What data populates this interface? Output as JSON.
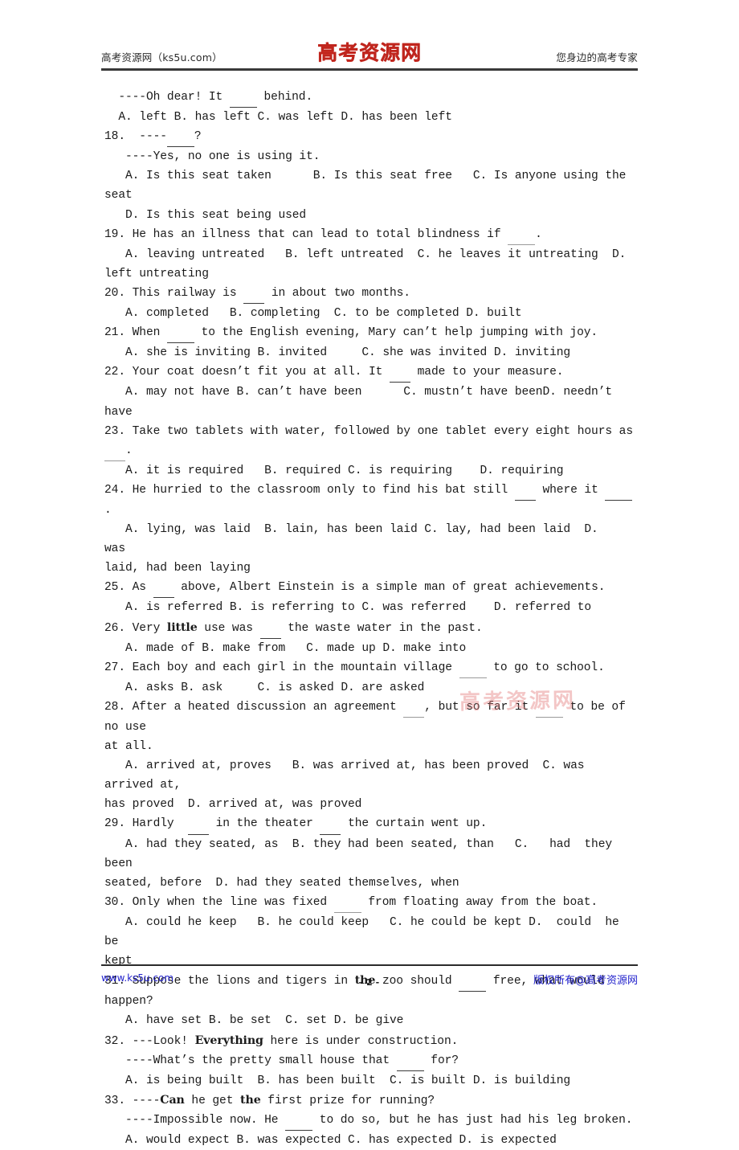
{
  "header": {
    "left_text": "高考资源网（ks5u.com）",
    "logo_text": "高考资源网",
    "right_text": "您身边的高考专家",
    "logo_color": "#c0251d"
  },
  "watermark": {
    "text": "高考资源网",
    "color": "#e27878"
  },
  "footer": {
    "left_text": "www.ks5u.com",
    "page_number": "- 2 -",
    "right_text": "版权所有@高考资源网",
    "link_color": "#2222cc"
  },
  "body": {
    "lines": [
      {
        "id": "l01",
        "segs": [
          {
            "t": "  ----Oh dear! It "
          },
          {
            "blank": "bl-m"
          },
          {
            "t": " behind."
          }
        ]
      },
      {
        "id": "l02",
        "segs": [
          {
            "t": "  A. left B. has left C. was left D. has been left"
          }
        ]
      },
      {
        "id": "l03",
        "segs": [
          {
            "t": "18.  ----"
          },
          {
            "blank": "bl-m"
          },
          {
            "t": "?"
          }
        ]
      },
      {
        "id": "l04",
        "segs": [
          {
            "t": "   ----Yes, no one is using it."
          }
        ]
      },
      {
        "id": "l05",
        "segs": [
          {
            "t": "   A. Is this seat taken      B. Is this seat free   C. Is anyone using the seat"
          }
        ]
      },
      {
        "id": "l06",
        "segs": [
          {
            "t": "   D. Is this seat being used"
          }
        ]
      },
      {
        "id": "l07",
        "segs": [
          {
            "t": "19. He has an illness that can lead to total blindness if "
          },
          {
            "blank": "bl-m bl-gr"
          },
          {
            "t": "."
          }
        ]
      },
      {
        "id": "l08",
        "segs": [
          {
            "t": "   A. leaving untreated   B. left untreated  C. he leaves it untreating  D."
          }
        ]
      },
      {
        "id": "l09",
        "segs": [
          {
            "t": "left untreating"
          }
        ]
      },
      {
        "id": "l10",
        "segs": [
          {
            "t": "20. This railway is "
          },
          {
            "blank": "bl-s"
          },
          {
            "t": " in about two months."
          }
        ]
      },
      {
        "id": "l11",
        "segs": [
          {
            "t": "   A. completed   B. completing  C. to be completed D. built"
          }
        ]
      },
      {
        "id": "l12",
        "segs": [
          {
            "t": "21. When "
          },
          {
            "blank": "bl-m"
          },
          {
            "t": " to the English evening, Mary can’t help jumping with joy."
          }
        ]
      },
      {
        "id": "l13",
        "segs": [
          {
            "t": "   A. she is inviting B. invited     C. she was invited D. inviting"
          }
        ]
      },
      {
        "id": "l14",
        "segs": [
          {
            "t": "22. Your coat doesn’t fit you at all. It "
          },
          {
            "blank": "bl-s"
          },
          {
            "t": " made to your measure."
          }
        ]
      },
      {
        "id": "l15",
        "segs": [
          {
            "t": "   A. may not have B. can’t have been      C. mustn’t have beenD. needn’t have"
          }
        ]
      },
      {
        "id": "l16",
        "segs": [
          {
            "t": "23. Take two tablets with water, followed by one tablet every eight hours as "
          },
          {
            "blank": "bl-s bl-gr"
          },
          {
            "t": "."
          }
        ]
      },
      {
        "id": "l17",
        "segs": [
          {
            "t": "   A. it is required   B. required C. is requiring    D. requiring"
          }
        ]
      },
      {
        "id": "l18",
        "segs": [
          {
            "t": "24. He hurried to the classroom only to find his bat still "
          },
          {
            "blank": "bl-s"
          },
          {
            "t": " where it "
          },
          {
            "blank": "bl-m"
          },
          {
            "t": "."
          }
        ]
      },
      {
        "id": "l19",
        "segs": [
          {
            "t": "   A. lying, was laid  B. lain, has been laid C. lay, had been laid  D.    was"
          }
        ]
      },
      {
        "id": "l20",
        "segs": [
          {
            "t": "laid, had been laying"
          }
        ]
      },
      {
        "id": "l21",
        "segs": [
          {
            "t": "25. As "
          },
          {
            "blank": "bl-s"
          },
          {
            "t": " above, Albert Einstein is a simple man of great achievements."
          }
        ]
      },
      {
        "id": "l22",
        "segs": [
          {
            "t": "   A. is referred B. is referring to C. was referred    D. referred to"
          }
        ]
      },
      {
        "id": "l23",
        "segs": [
          {
            "t": "26. Very "
          },
          {
            "b": "little"
          },
          {
            "t": " use was "
          },
          {
            "blank": "bl-s"
          },
          {
            "t": " the waste water in the past."
          }
        ]
      },
      {
        "id": "l24",
        "segs": [
          {
            "t": "   A. made of B. make from   C. made up D. make into"
          }
        ]
      },
      {
        "id": "l25",
        "segs": [
          {
            "t": "27. Each boy and each girl in the mountain village "
          },
          {
            "blank": "bl-m bl-gr"
          },
          {
            "t": " to go to school."
          }
        ]
      },
      {
        "id": "l26",
        "segs": [
          {
            "t": "   A. asks B. ask     C. is asked D. are asked"
          }
        ]
      },
      {
        "id": "l27",
        "segs": [
          {
            "t": "28. After a heated discussion an agreement "
          },
          {
            "blank": "bl-s bl-gr"
          },
          {
            "t": ", but so far it "
          },
          {
            "blank": "bl-m bl-gr"
          },
          {
            "t": " to be of no use"
          }
        ]
      },
      {
        "id": "l28",
        "segs": [
          {
            "t": "at all."
          }
        ]
      },
      {
        "id": "l29",
        "segs": [
          {
            "t": "   A. arrived at, proves   B. was arrived at, has been proved  C. was arrived at,"
          }
        ]
      },
      {
        "id": "l30",
        "segs": [
          {
            "t": "has proved  D. arrived at, was proved"
          }
        ]
      },
      {
        "id": "l31",
        "segs": [
          {
            "t": "29. Hardly  "
          },
          {
            "blank": "bl-s"
          },
          {
            "t": " in the theater "
          },
          {
            "blank": "bl-s"
          },
          {
            "t": " the curtain went up."
          }
        ]
      },
      {
        "id": "l32",
        "segs": [
          {
            "t": "   A. had they seated, as  B. they had been seated, than   C.   had  they  been"
          }
        ]
      },
      {
        "id": "l33",
        "segs": [
          {
            "t": "seated, before  D. had they seated themselves, when"
          }
        ]
      },
      {
        "id": "l34",
        "segs": [
          {
            "t": "30. Only when the line was fixed "
          },
          {
            "blank": "bl-m bl-gr"
          },
          {
            "t": " from floating away from the boat."
          }
        ]
      },
      {
        "id": "l35",
        "segs": [
          {
            "t": "   A. could he keep   B. he could keep   C. he could be kept D.  could  he  be"
          }
        ]
      },
      {
        "id": "l36",
        "segs": [
          {
            "t": "kept"
          }
        ]
      },
      {
        "id": "l37",
        "segs": [
          {
            "t": "31. Suppose the lions and tigers in "
          },
          {
            "b": "the"
          },
          {
            "t": " zoo should "
          },
          {
            "blank": "bl-m"
          },
          {
            "t": " free, what would happen?"
          }
        ]
      },
      {
        "id": "l38",
        "segs": [
          {
            "t": "   A. have set B. be set  C. set D. be give"
          }
        ]
      },
      {
        "id": "l39",
        "segs": [
          {
            "t": "32. ---Look! "
          },
          {
            "b": "Everything"
          },
          {
            "t": " here is under construction."
          }
        ]
      },
      {
        "id": "l40",
        "segs": [
          {
            "t": "   ----What’s the pretty small house that "
          },
          {
            "blank": "bl-m"
          },
          {
            "t": " for?"
          }
        ]
      },
      {
        "id": "l41",
        "segs": [
          {
            "t": "   A. is being built  B. has been built  C. is built D. is building"
          }
        ]
      },
      {
        "id": "l42",
        "segs": [
          {
            "t": "33. ----"
          },
          {
            "b": "Can"
          },
          {
            "t": " he get "
          },
          {
            "b": "the"
          },
          {
            "t": " first prize for running?"
          }
        ]
      },
      {
        "id": "l43",
        "segs": [
          {
            "t": "   ----Impossible now. He "
          },
          {
            "blank": "bl-m"
          },
          {
            "t": " to do so, but he has just had his leg broken."
          }
        ]
      },
      {
        "id": "l44",
        "segs": [
          {
            "t": "   A. would expect B. was expected C. has expected D. is expected"
          }
        ]
      }
    ]
  }
}
